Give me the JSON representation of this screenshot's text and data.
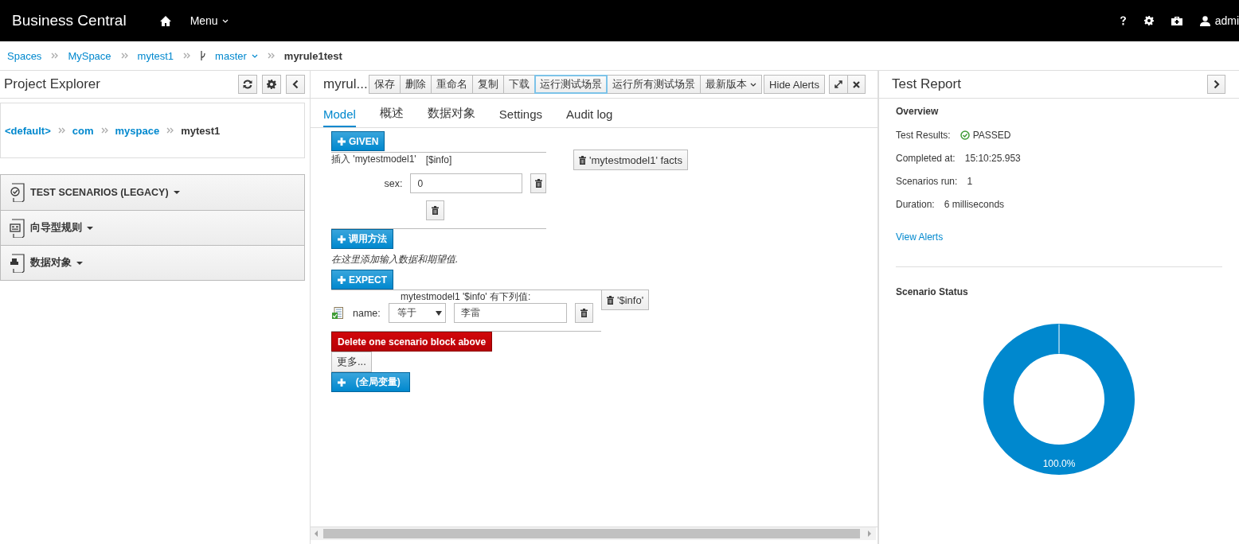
{
  "header": {
    "brand": "Business Central",
    "menu": "Menu",
    "user": "admi"
  },
  "breadcrumb": [
    {
      "label": "Spaces",
      "kind": "link"
    },
    {
      "label": "MySpace",
      "kind": "link"
    },
    {
      "label": "mytest1",
      "kind": "link"
    },
    {
      "label": "master",
      "kind": "branch"
    },
    {
      "label": "myrule1test",
      "kind": "current"
    }
  ],
  "project_explorer": {
    "title": "Project Explorer",
    "path": [
      {
        "label": "<default>",
        "kind": "link"
      },
      {
        "label": "com",
        "kind": "link"
      },
      {
        "label": "myspace",
        "kind": "link"
      },
      {
        "label": "mytest1",
        "kind": "current"
      }
    ],
    "groups": [
      {
        "label": "TEST SCENARIOS (LEGACY)",
        "kind": "scenario"
      },
      {
        "label": "向导型规则",
        "kind": "guided"
      },
      {
        "label": "数据对象",
        "kind": "data"
      }
    ]
  },
  "editor": {
    "title": "myrul...",
    "toolbar": [
      {
        "label": "保存",
        "kind": "plain",
        "selected": false
      },
      {
        "label": "删除",
        "kind": "plain",
        "selected": false
      },
      {
        "label": "重命名",
        "kind": "plain",
        "selected": false
      },
      {
        "label": "复制",
        "kind": "plain",
        "selected": false
      },
      {
        "label": "下载",
        "kind": "plain",
        "selected": false
      },
      {
        "label": "运行测试场景",
        "kind": "plain",
        "selected": true
      },
      {
        "label": "运行所有测试场景",
        "kind": "plain",
        "selected": false
      },
      {
        "label": "最新版本",
        "kind": "dropdown",
        "selected": false
      }
    ],
    "hide_alerts": "Hide Alerts",
    "tabs": [
      {
        "label": "Model",
        "selected": true
      },
      {
        "label": "概述",
        "selected": false
      },
      {
        "label": "数据对象",
        "selected": false
      },
      {
        "label": "Settings",
        "selected": false
      },
      {
        "label": "Audit log",
        "selected": false
      }
    ],
    "given": {
      "button": "GIVEN",
      "insert": "插入 'mytestmodel1'",
      "binding": "[$info]",
      "fields": [
        {
          "label": "sex:",
          "value": "0"
        }
      ],
      "remove": "'mytestmodel1' facts"
    },
    "call_method": "调用方法",
    "hint": "在这里添加输入数据和期望值.",
    "expect": {
      "button": "EXPECT",
      "heading": "mytestmodel1 '$info' 有下列值:",
      "remove": "'$info'",
      "fields": [
        {
          "label": "name:",
          "operator": "等于",
          "value": "李雷"
        }
      ]
    },
    "delete_block": "Delete one scenario block above",
    "more": "更多...",
    "globals": "(全局变量)"
  },
  "test_report": {
    "title": "Test Report",
    "overview": "Overview",
    "stats": [
      {
        "label": "Test Results:",
        "value": "PASSED",
        "kind": "status"
      },
      {
        "label": "Completed at:",
        "value": "15:10:25.953",
        "kind": "text"
      },
      {
        "label": "Scenarios run:",
        "value": "1",
        "kind": "text"
      },
      {
        "label": "Duration:",
        "value": "6 milliseconds",
        "kind": "text"
      }
    ],
    "view_alerts": "View Alerts",
    "scenario_status": "Scenario Status",
    "status_share": "100.0%"
  }
}
